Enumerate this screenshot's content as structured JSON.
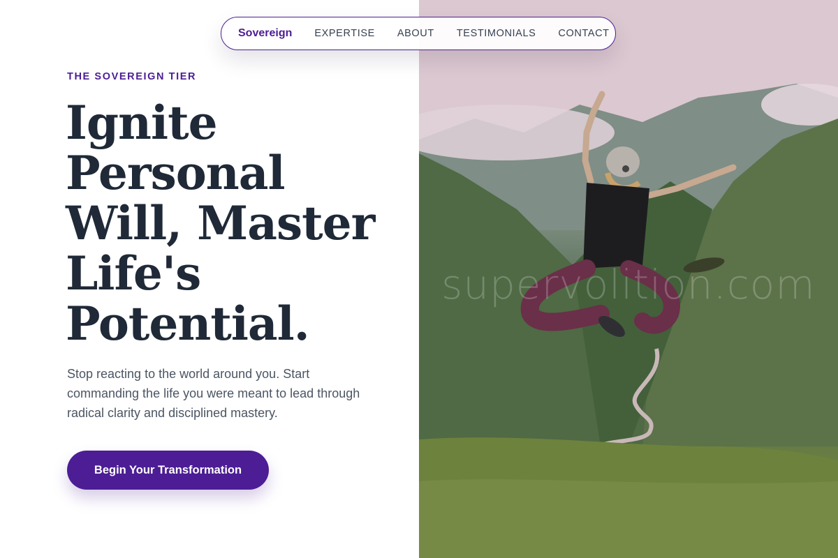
{
  "nav": {
    "brand": "Sovereign",
    "links": [
      "EXPERTISE",
      "ABOUT",
      "TESTIMONIALS",
      "CONTACT"
    ]
  },
  "hero": {
    "eyebrow": "THE SOVEREIGN TIER",
    "headline_lines": [
      "Ignite",
      "Personal",
      "Will, Master",
      "Life's",
      "Potential."
    ],
    "subcopy": "Stop reacting to the world around you. Start commanding the life you were meant to lead through radical clarity and disciplined mastery.",
    "cta_label": "Begin Your Transformation"
  },
  "image": {
    "watermark": "supervolition.com"
  },
  "colors": {
    "accent": "#4c1d95",
    "heading": "#1f2937",
    "body": "#4b5563",
    "nav_text": "#374151"
  }
}
